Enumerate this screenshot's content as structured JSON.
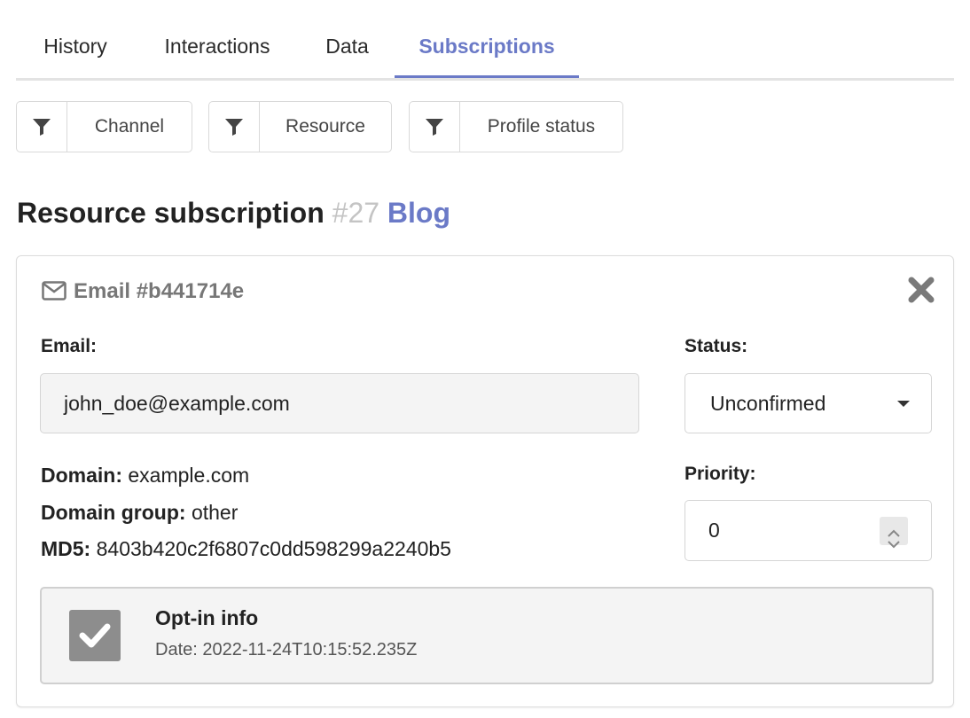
{
  "tabs": [
    "History",
    "Interactions",
    "Data",
    "Subscriptions"
  ],
  "active_tab": "Subscriptions",
  "filters": [
    "Channel",
    "Resource",
    "Profile status"
  ],
  "title": {
    "text": "Resource subscription",
    "number": "#27",
    "resource": "Blog"
  },
  "card": {
    "header": "Email #b441714e",
    "email_label": "Email:",
    "email_value": "john_doe@example.com",
    "status_label": "Status:",
    "status_value": "Unconfirmed",
    "priority_label": "Priority:",
    "priority_value": "0",
    "domain_label": "Domain:",
    "domain_value": "example.com",
    "domain_group_label": "Domain group:",
    "domain_group_value": "other",
    "md5_label": "MD5:",
    "md5_value": "8403b420c2f6807c0dd598299a2240b5",
    "optin_title": "Opt-in info",
    "optin_date": "Date: 2022-11-24T10:15:52.235Z",
    "optin_checked": true
  },
  "colors": {
    "accent": "#6b7ac7",
    "muted": "#c4c4c4",
    "checkbox": "#8d8d8d"
  }
}
